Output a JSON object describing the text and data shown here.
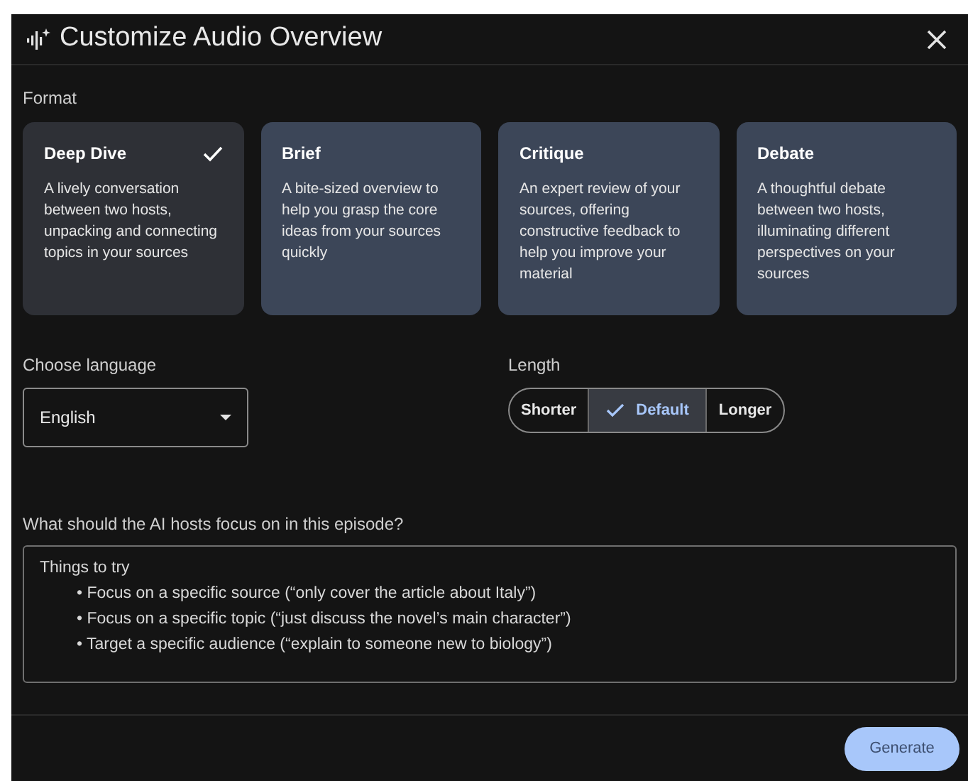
{
  "dialog": {
    "title": "Customize Audio Overview"
  },
  "format": {
    "label": "Format",
    "options": [
      {
        "title": "Deep Dive",
        "description": "A lively conversation between two hosts, unpacking and connecting topics in your sources",
        "selected": true
      },
      {
        "title": "Brief",
        "description": "A bite-sized overview to help you grasp the core ideas from your sources quickly",
        "selected": false
      },
      {
        "title": "Critique",
        "description": "An expert review of your sources, offering constructive feedback to help you improve your material",
        "selected": false
      },
      {
        "title": "Debate",
        "description": "A thoughtful debate between two hosts, illuminating different perspectives on your sources",
        "selected": false
      }
    ]
  },
  "language": {
    "label": "Choose language",
    "value": "English"
  },
  "length": {
    "label": "Length",
    "options": [
      {
        "label": "Shorter",
        "selected": false
      },
      {
        "label": "Default",
        "selected": true
      },
      {
        "label": "Longer",
        "selected": false
      }
    ]
  },
  "focus": {
    "label": "What should the AI hosts focus on in this episode?",
    "placeholder_title": "Things to try",
    "placeholder_items": [
      "• Focus on a specific source (“only cover the article about Italy”)",
      "• Focus on a specific topic (“just discuss the novel’s main character”)",
      "• Target a specific audience (“explain to someone new to biology”)"
    ]
  },
  "generate_button": "Generate"
}
